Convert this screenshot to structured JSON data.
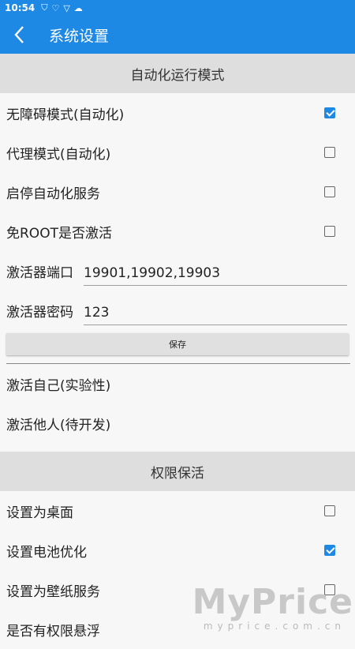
{
  "status_bar": {
    "time": "10:54",
    "icons": [
      "shield-icon",
      "heart-shield-icon",
      "v-shield-icon",
      "cloud-icon"
    ]
  },
  "app_bar": {
    "back_icon": "‹",
    "title": "系统设置"
  },
  "colors": {
    "accent": "#1e88e5",
    "section_bg": "#dedede",
    "page_bg": "#f7f7f7"
  },
  "automation": {
    "header": "自动化运行模式",
    "options": [
      {
        "label": "无障碍模式(自动化)",
        "checked": true
      },
      {
        "label": "代理模式(自动化)",
        "checked": false
      },
      {
        "label": "启停自动化服务",
        "checked": false
      },
      {
        "label": "免ROOT是否激活",
        "checked": false
      }
    ],
    "port_label": "激活器端口",
    "port_value": "19901,19902,19903",
    "password_label": "激活器密码",
    "password_value": "123",
    "save_label": "保存",
    "activate_self": "激活自己(实验性)",
    "activate_others": "激活他人(待开发)"
  },
  "keepalive": {
    "header": "权限保活",
    "options": [
      {
        "label": "设置为桌面",
        "checked": false
      },
      {
        "label": "设置电池优化",
        "checked": true
      },
      {
        "label": "设置为壁纸服务",
        "checked": false
      }
    ],
    "partial_next": "是否有权限悬浮"
  },
  "watermark": {
    "main": "MyPrice",
    "sub": "myprice.com.cn"
  }
}
